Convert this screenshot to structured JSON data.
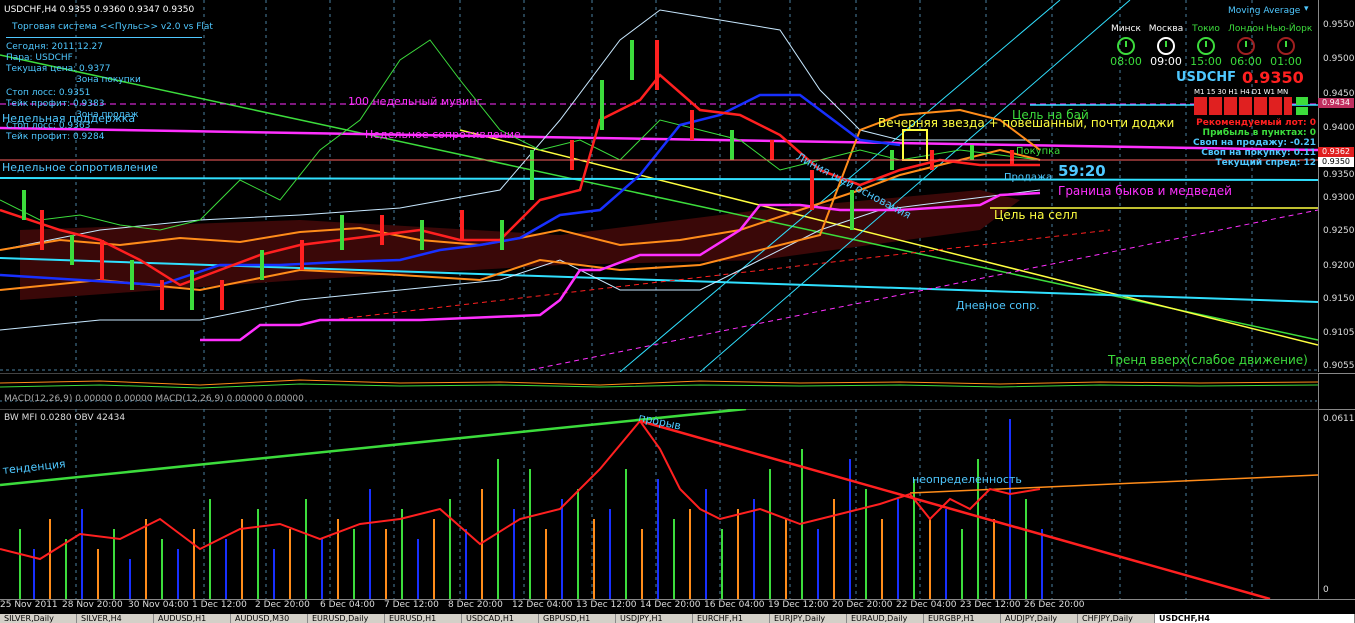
{
  "main_chart": {
    "header": "USDCHF,H4  0.9355 0.9360 0.9347 0.9350",
    "indicator_name": "Moving Average"
  },
  "info_panel": {
    "system_title": "Торговая система <<Пульс>> v2.0 vs Flat",
    "today": "Сегодня:  2011.12.27",
    "pair": "Пара:   USDCHF",
    "current_price": "Текущая цена: 0.9377",
    "buy_zone": "Зона покупки",
    "stop_loss_1": "Стоп лосс:       0.9351",
    "take_profit_1": "Тейк профит:    0.9383",
    "sell_zone": "Зона продаж",
    "stop_loss_2": "Стоп лосс:       0.9363",
    "take_profit_2": "Тейк профит:    0.9284"
  },
  "annotations": {
    "weekly_ma": "100 недельный мувинг",
    "weekly_resistance": "Недельное сопротивление",
    "weekly_support": "Недельная поддержка",
    "weekly_resistance_2": "Недельное сопротивление",
    "evening_star": "Вечерняя звезда + повешанный, почти доджи",
    "buy_target": "Цель на бай",
    "sell_target": "Цель на селл",
    "bull_bear_border": "Границa быков и медведей",
    "daily_resistance": "Дневное сопр.",
    "uptrend": "Тренд вверх(слабое движение)",
    "neckline": "Линия шеи основания",
    "buy_label": "Покупка",
    "sell_label": "Продажа",
    "timer": "59:20",
    "breakout": "прорыв",
    "uncertainty": "неопределенность",
    "trend_label": "тенденция"
  },
  "clocks": [
    {
      "city": "Минск",
      "time": "08:00"
    },
    {
      "city": "Москва",
      "time": "09:00"
    },
    {
      "city": "Токио",
      "time": "15:00"
    },
    {
      "city": "Лондон",
      "time": "06:00"
    },
    {
      "city": "Нью-Йорк",
      "time": "01:00"
    }
  ],
  "symbol_panel": {
    "symbol": "USDCHF",
    "price": "0.9350",
    "timeframes": [
      "M1",
      "15",
      "30",
      "H1",
      "H4",
      "D1",
      "W1",
      "MN"
    ],
    "rec_lot": "Рекомендуемый лот: 0",
    "profit_points": "Прибыль в пунктах: 0",
    "swap_sell": "Своп на продажу: -0.21",
    "swap_buy": "Своп на покупку: 0.11",
    "spread": "Текущий спред: 12"
  },
  "price_axis": {
    "ticks": [
      "0.9550",
      "0.9500",
      "0.9450",
      "0.9400",
      "0.9350",
      "0.9300",
      "0.9250",
      "0.9200",
      "0.9150",
      "0.9105",
      "0.9055"
    ],
    "highlight_1": "0.9434",
    "highlight_2": "0.9362",
    "highlight_3": "0.9350"
  },
  "macd_panel": {
    "label": "MACD(12,26,9) 0.00000 0.00000   MACD(12,26,9) 0.00000 0.00000"
  },
  "mfi_panel": {
    "label": "BW MFI 0.0280  OBV 42434",
    "top_value": "0.0611",
    "bottom_value": "0"
  },
  "date_axis": [
    "25 Nov 2011",
    "28 Nov 20:00",
    "30 Nov 04:00",
    "1 Dec 12:00",
    "2 Dec 20:00",
    "6 Dec 04:00",
    "7 Dec 12:00",
    "8 Dec 20:00",
    "12 Dec 04:00",
    "13 Dec 12:00",
    "14 Dec 20:00",
    "16 Dec 04:00",
    "19 Dec 12:00",
    "20 Dec 20:00",
    "22 Dec 04:00",
    "23 Dec 12:00",
    "26 Dec 20:00"
  ],
  "tabs": [
    "SILVER,Daily",
    "SILVER,H4",
    "AUDUSD,H1",
    "AUDUSD,M30",
    "EURUSD,Daily",
    "EURUSD,H1",
    "USDCAD,H1",
    "GBPUSD,H1",
    "USDJPY,H1",
    "EURCHF,H1",
    "EURJPY,Daily",
    "EURAUD,Daily",
    "EURGBP,H1",
    "AUDJPY,Daily",
    "CHFJPY,Daily",
    "USDCHF,H4"
  ],
  "colors": {
    "grid": "#4a7fa0",
    "green": "#3cdc3c",
    "red": "#ff2020",
    "blue": "#1830ff",
    "orange": "#ff8c1a",
    "magenta": "#ff30ff",
    "cyan": "#30e0ff",
    "yellow": "#ffff40"
  }
}
